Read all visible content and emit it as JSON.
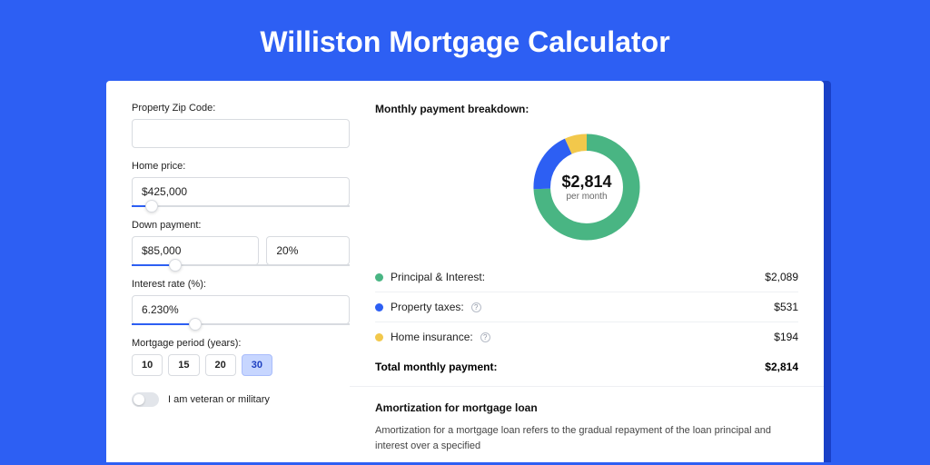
{
  "title": "Williston Mortgage Calculator",
  "form": {
    "zip": {
      "label": "Property Zip Code:",
      "value": ""
    },
    "home_price": {
      "label": "Home price:",
      "value": "$425,000",
      "slider_pct": 9
    },
    "down_payment": {
      "label": "Down payment:",
      "amount": "$85,000",
      "percent": "20%",
      "slider_pct": 20
    },
    "interest": {
      "label": "Interest rate (%):",
      "value": "6.230%",
      "slider_pct": 29
    },
    "period": {
      "label": "Mortgage period (years):",
      "options": [
        "10",
        "15",
        "20",
        "30"
      ],
      "selected": "30"
    },
    "veteran": {
      "label": "I am veteran or military",
      "on": false
    }
  },
  "breakdown": {
    "title": "Monthly payment breakdown:",
    "center_amount": "$2,814",
    "center_sub": "per month",
    "rows": [
      {
        "color": "green",
        "label": "Principal & Interest:",
        "info": false,
        "value": "$2,089"
      },
      {
        "color": "blue",
        "label": "Property taxes:",
        "info": true,
        "value": "$531"
      },
      {
        "color": "yellow",
        "label": "Home insurance:",
        "info": true,
        "value": "$194"
      }
    ],
    "total_label": "Total monthly payment:",
    "total_value": "$2,814"
  },
  "chart_data": {
    "type": "pie",
    "title": "Monthly payment breakdown",
    "series": [
      {
        "name": "Principal & Interest",
        "value": 2089,
        "color": "#49b583"
      },
      {
        "name": "Property taxes",
        "value": 531,
        "color": "#2d5ff3"
      },
      {
        "name": "Home insurance",
        "value": 194,
        "color": "#f2c84b"
      }
    ],
    "total": 2814
  },
  "amortization": {
    "title": "Amortization for mortgage loan",
    "body": "Amortization for a mortgage loan refers to the gradual repayment of the loan principal and interest over a specified"
  }
}
